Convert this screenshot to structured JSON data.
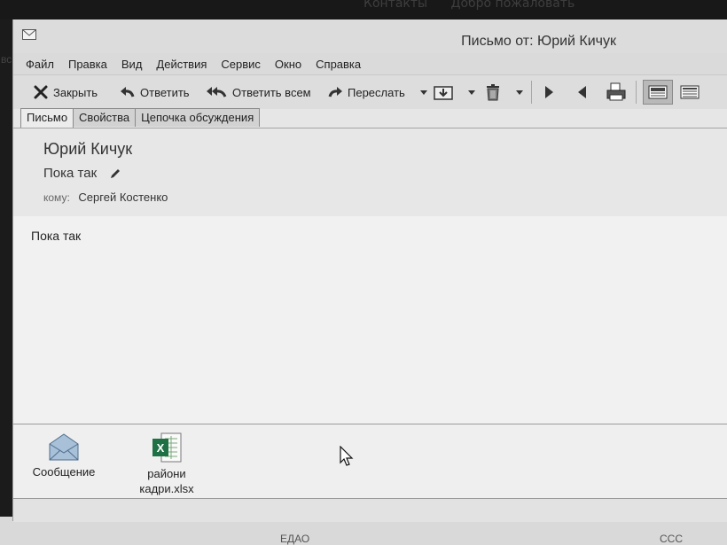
{
  "background": {
    "top_tabs": [
      "Контакты",
      "Добро пожаловать"
    ],
    "bottom_left": "ЕДАО",
    "bottom_right": "ССС"
  },
  "window": {
    "title": "Письмо от: Юрий Кичук",
    "left_edge_label": "вс"
  },
  "menu": [
    "Файл",
    "Правка",
    "Вид",
    "Действия",
    "Сервис",
    "Окно",
    "Справка"
  ],
  "toolbar": {
    "close_label": "Закрыть",
    "reply_label": "Ответить",
    "reply_all_label": "Ответить всем",
    "forward_label": "Переслать"
  },
  "tabs": [
    "Письмо",
    "Свойства",
    "Цепочка обсуждения"
  ],
  "message": {
    "sender": "Юрий Кичук",
    "subject": "Пока так",
    "to_label": "кому:",
    "to_value": "Сергей Костенко",
    "body": "Пока так"
  },
  "attachments": [
    {
      "label": "Сообщение",
      "icon": "envelope-icon"
    },
    {
      "label": "райони кадри.xlsx",
      "icon": "excel-file-icon"
    }
  ],
  "colors": {
    "window_bg": "#e6e6e6",
    "body_bg": "#f1f1f1",
    "excel_green": "#1e7145"
  }
}
